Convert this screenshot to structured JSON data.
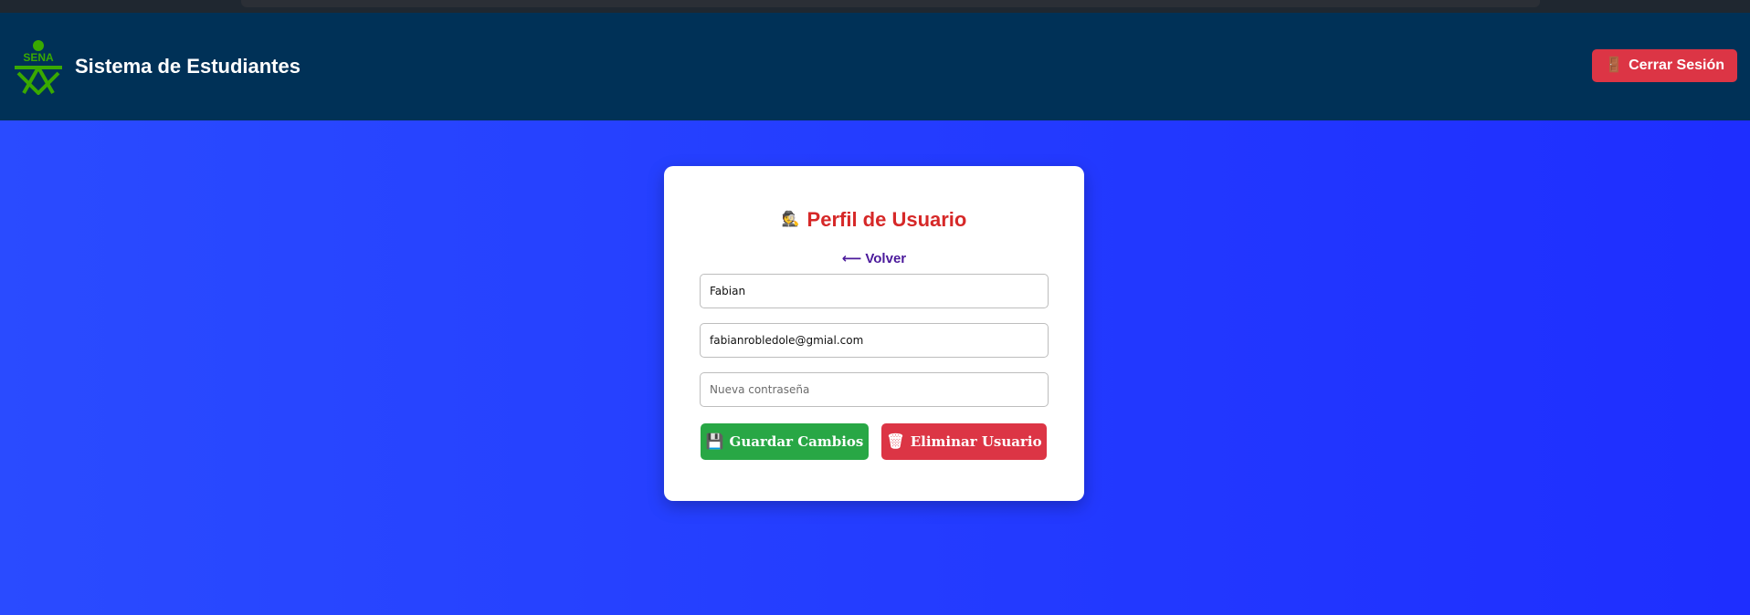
{
  "header": {
    "logo_text": "SENA",
    "title": "Sistema de Estudiantes",
    "logout_icon": "door-icon",
    "logout_label": "Cerrar Sesión"
  },
  "profile": {
    "title_icon": "user-icon",
    "title": "Perfil de Usuario",
    "back_label": "Volver",
    "back_icon": "left-arrow-icon",
    "fields": {
      "name_value": "Fabian",
      "email_value": "fabianrobledole@gmial.com",
      "password_placeholder": "Nueva contraseña"
    },
    "save_icon": "floppy-disk-icon",
    "save_label": "Guardar Cambios",
    "delete_icon": "trash-icon",
    "delete_label": "Eliminar Usuario"
  },
  "colors": {
    "header_bg": "#003157",
    "page_bg": "#2a4bff",
    "accent_red": "#dc3545",
    "accent_green": "#28a745",
    "title_red": "#d62828",
    "link_purple": "#4b1a9b",
    "logo_green": "#39a900"
  }
}
